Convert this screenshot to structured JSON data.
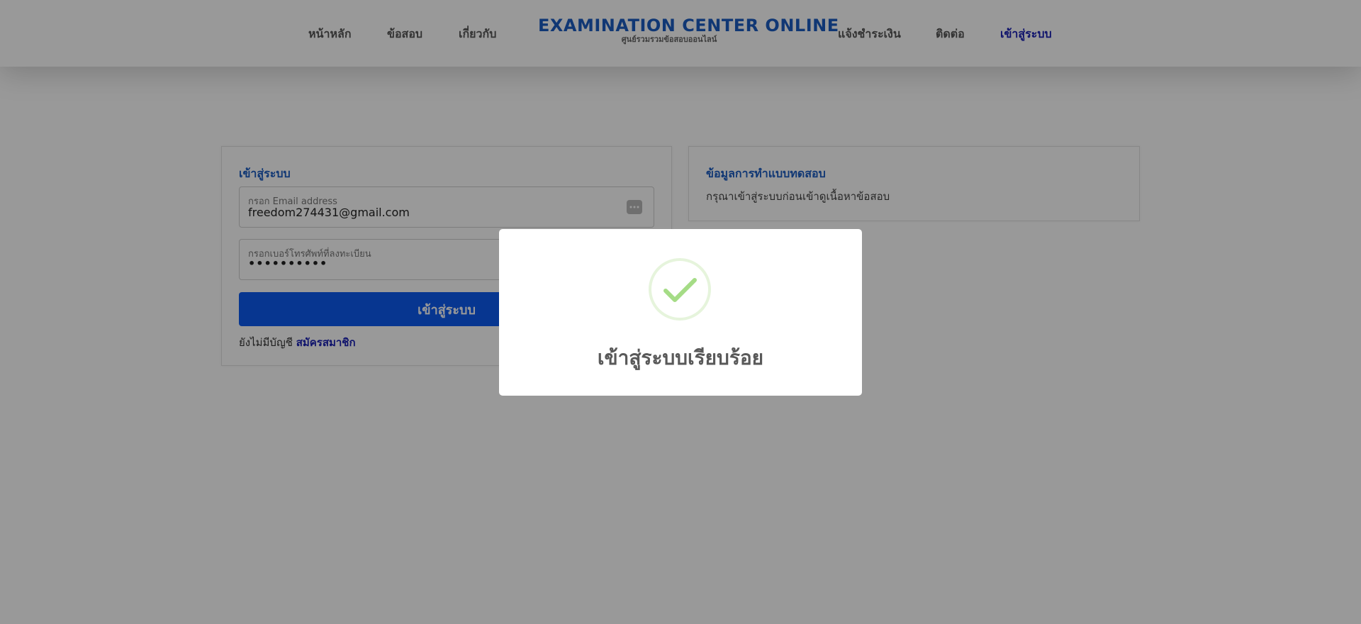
{
  "nav": {
    "left_items": [
      "หน้าหลัก",
      "ข้อสอบ",
      "เกี่ยวกับ"
    ],
    "right_items": [
      "แจ้งชำระเงิน",
      "ติดต่อ"
    ],
    "login": "เข้าสู่ระบบ"
  },
  "brand": {
    "title": "EXAMINATION CENTER ONLINE",
    "subtitle": "ศูนย์รวมรวมข้อสอบออนไลน์"
  },
  "login_card": {
    "heading": "เข้าสู่ระบบ",
    "email_label": "กรอก Email address",
    "email_value": "freedom274431@gmail.com",
    "phone_label": "กรอกเบอร์โทรศัพท์ที่ลงทะเบียน",
    "phone_value": "••••••••••",
    "button_label": "เข้าสู่ระบบ",
    "no_account_text": "ยังไม่มีบัญชี",
    "signup_link": "สมัครสมาชิก"
  },
  "info_card": {
    "heading": "ข้อมูลการทำแบบทดสอบ",
    "text": "กรุณาเข้าสู่ระบบก่อนเข้าดูเนื้อหาข้อสอบ"
  },
  "modal": {
    "icon": "success-check-icon",
    "title": "เข้าสู่ระบบเรียบร้อย"
  },
  "colors": {
    "brand": "#1c5dc2",
    "primary_button": "#0c5bf1",
    "link": "#1a21b5",
    "success": "#a5dc86"
  }
}
